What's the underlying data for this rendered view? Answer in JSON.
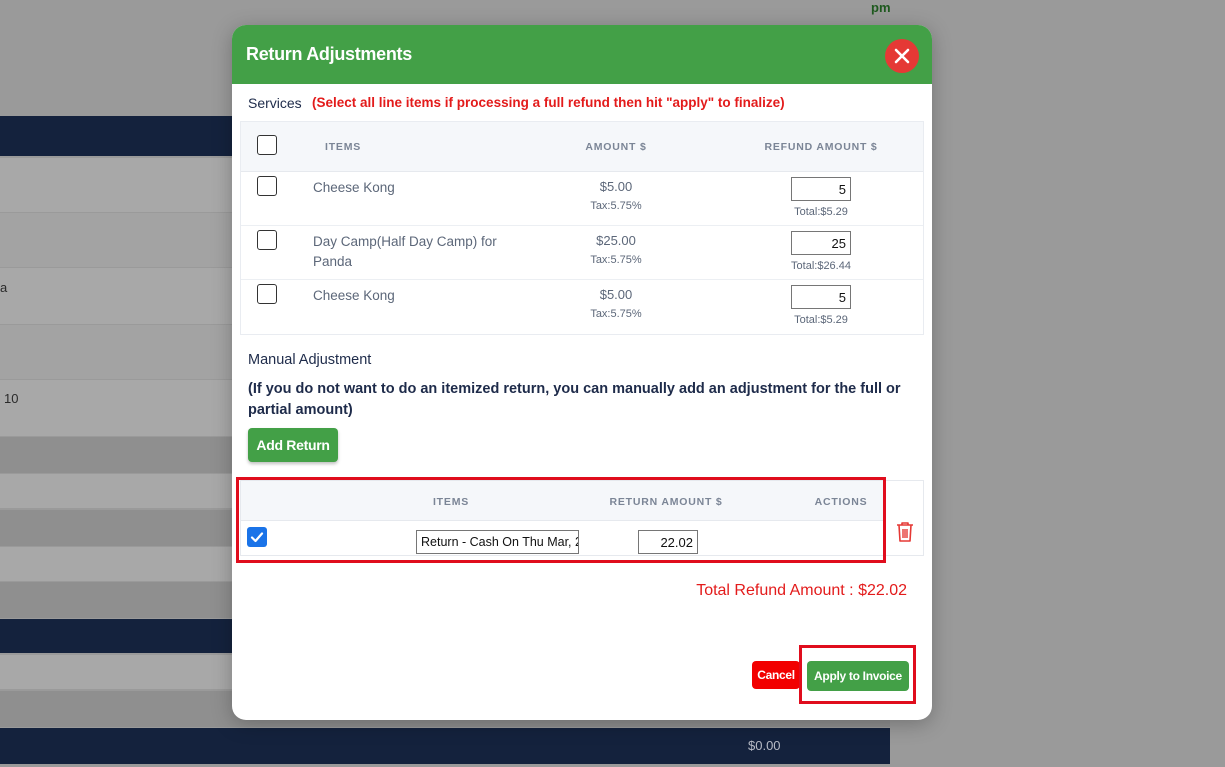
{
  "background": {
    "corner_text": "pm",
    "row_texts": [
      "a",
      "10"
    ],
    "footer_amount": "$0.00"
  },
  "modal": {
    "title": "Return Adjustments",
    "services_label": "Services",
    "services_note": "(Select all line items if processing a full refund then hit \"apply\" to finalize)",
    "services_columns": [
      "ITEMS",
      "AMOUNT $",
      "REFUND AMOUNT $"
    ],
    "services": [
      {
        "name": "Cheese Kong",
        "amount": "$5.00",
        "tax": "Tax:5.75%",
        "refund": "5",
        "total": "Total:$5.29",
        "checked": false
      },
      {
        "name": "Day Camp(Half Day Camp) for Panda",
        "amount": "$25.00",
        "tax": "Tax:5.75%",
        "refund": "25",
        "total": "Total:$26.44",
        "checked": false
      },
      {
        "name": "Cheese Kong",
        "amount": "$5.00",
        "tax": "Tax:5.75%",
        "refund": "5",
        "total": "Total:$5.29",
        "checked": false
      }
    ],
    "manual_title": "Manual Adjustment",
    "manual_desc": "(If you do not want to do an itemized return, you can manually add an adjustment for the full or partial amount)",
    "add_return_label": "Add Return",
    "return_columns": [
      "ITEMS",
      "RETURN AMOUNT $",
      "ACTIONS"
    ],
    "return_row": {
      "checked": true,
      "item": "Return - Cash On Thu Mar, 2",
      "amount": "22.02"
    },
    "total_refund": "Total Refund Amount : $22.02",
    "cancel_label": "Cancel",
    "apply_label": "Apply to Invoice"
  },
  "colors": {
    "accent_green": "#43a047",
    "danger_red": "#e31b1b",
    "navy": "#14223d"
  }
}
